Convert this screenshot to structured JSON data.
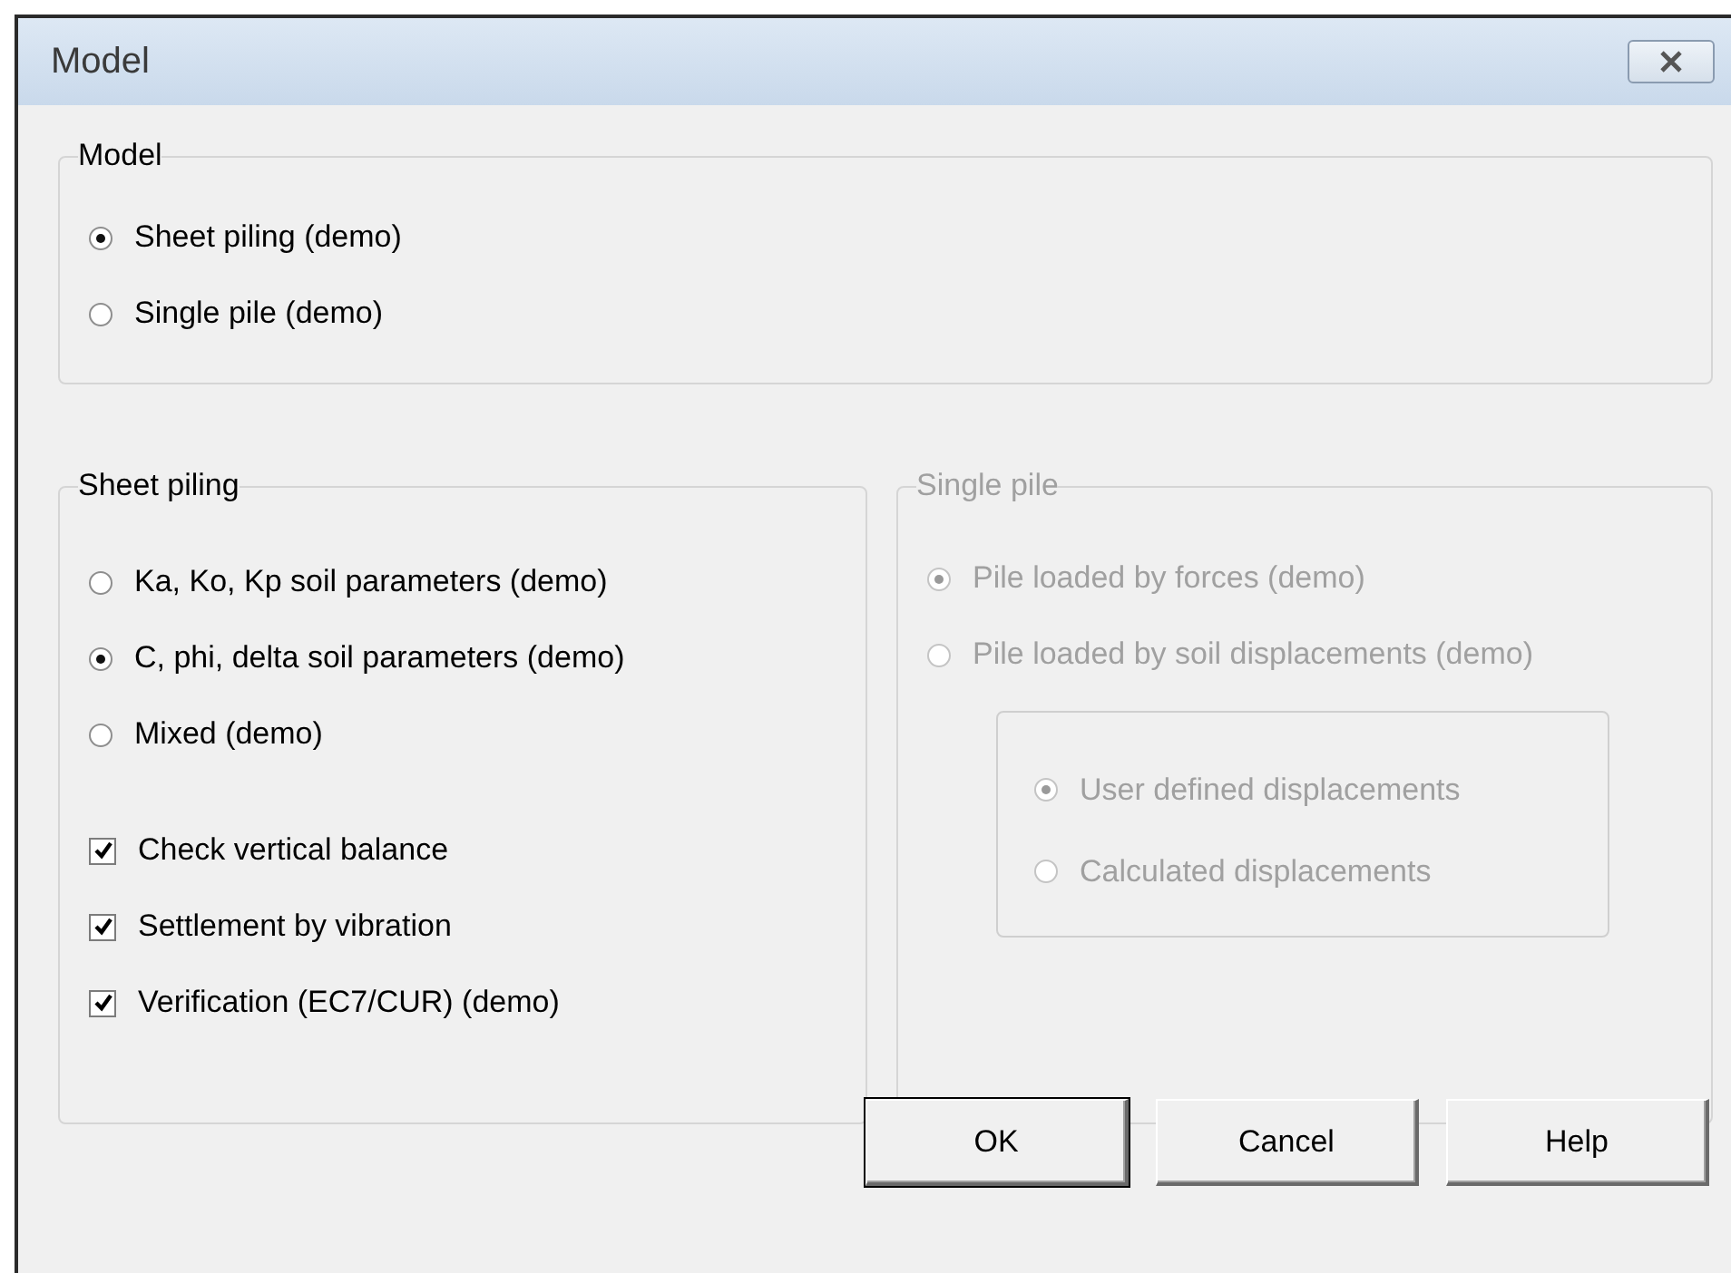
{
  "window": {
    "title": "Model"
  },
  "model_group": {
    "title": "Model",
    "options": [
      {
        "label": "Sheet piling (demo)",
        "selected": true
      },
      {
        "label": "Single pile (demo)",
        "selected": false
      }
    ]
  },
  "sheet_piling": {
    "title": "Sheet piling",
    "options": [
      {
        "label": "Ka, Ko, Kp soil parameters (demo)",
        "selected": false
      },
      {
        "label": "C, phi, delta soil parameters (demo)",
        "selected": true
      },
      {
        "label": "Mixed (demo)",
        "selected": false
      }
    ],
    "checkboxes": [
      {
        "label": "Check vertical balance",
        "checked": true
      },
      {
        "label": "Settlement by vibration",
        "checked": true
      },
      {
        "label": "Verification (EC7/CUR) (demo)",
        "checked": true
      }
    ]
  },
  "single_pile": {
    "title": "Single pile",
    "disabled": true,
    "options": [
      {
        "label": "Pile loaded by forces (demo)",
        "selected": true
      },
      {
        "label": "Pile loaded by soil displacements (demo)",
        "selected": false
      }
    ],
    "displacement_options": [
      {
        "label": "User defined displacements",
        "selected": true
      },
      {
        "label": "Calculated displacements",
        "selected": false
      }
    ]
  },
  "buttons": [
    {
      "label": "OK",
      "default": true
    },
    {
      "label": "Cancel",
      "default": false
    },
    {
      "label": "Help",
      "default": false
    }
  ]
}
